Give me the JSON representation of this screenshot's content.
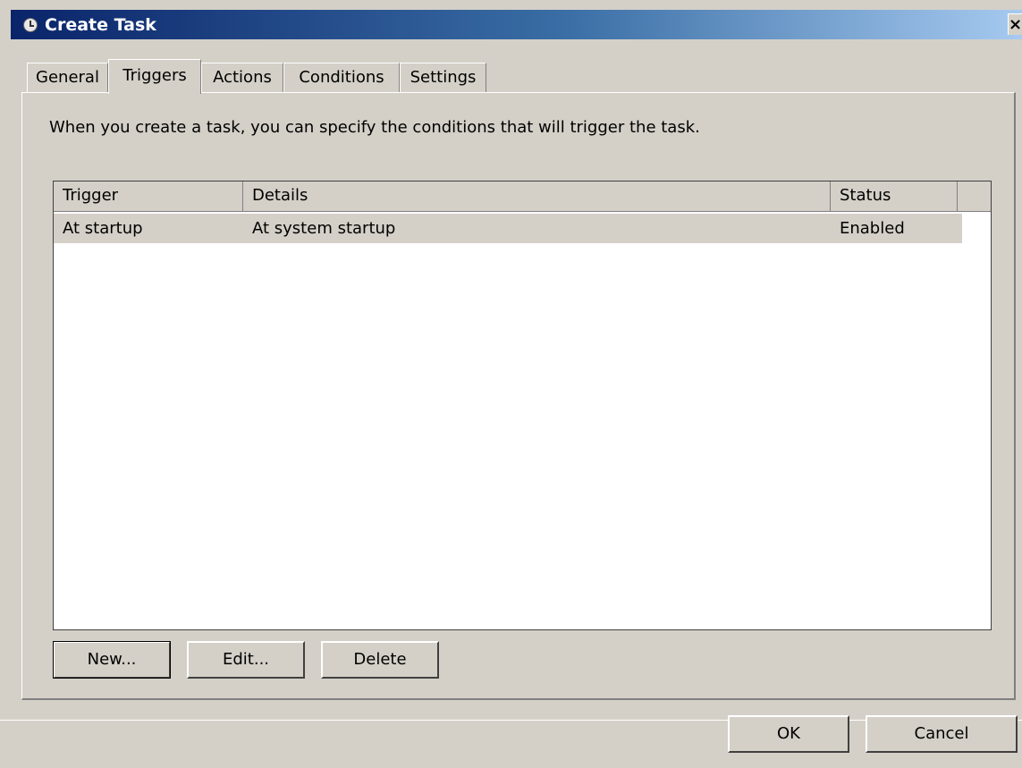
{
  "window": {
    "title": "Create Task",
    "close_label": "×"
  },
  "tabs": [
    {
      "label": "General",
      "active": false
    },
    {
      "label": "Triggers",
      "active": true
    },
    {
      "label": "Actions",
      "active": false
    },
    {
      "label": "Conditions",
      "active": false
    },
    {
      "label": "Settings",
      "active": false
    }
  ],
  "triggers_tab": {
    "description": "When you create a task, you can specify the conditions that will trigger the task.",
    "columns": [
      "Trigger",
      "Details",
      "Status"
    ],
    "rows": [
      {
        "trigger": "At startup",
        "details": "At system startup",
        "status": "Enabled"
      }
    ],
    "buttons": {
      "new": "New...",
      "edit": "Edit...",
      "delete": "Delete"
    }
  },
  "dialog_buttons": {
    "ok": "OK",
    "cancel": "Cancel"
  }
}
